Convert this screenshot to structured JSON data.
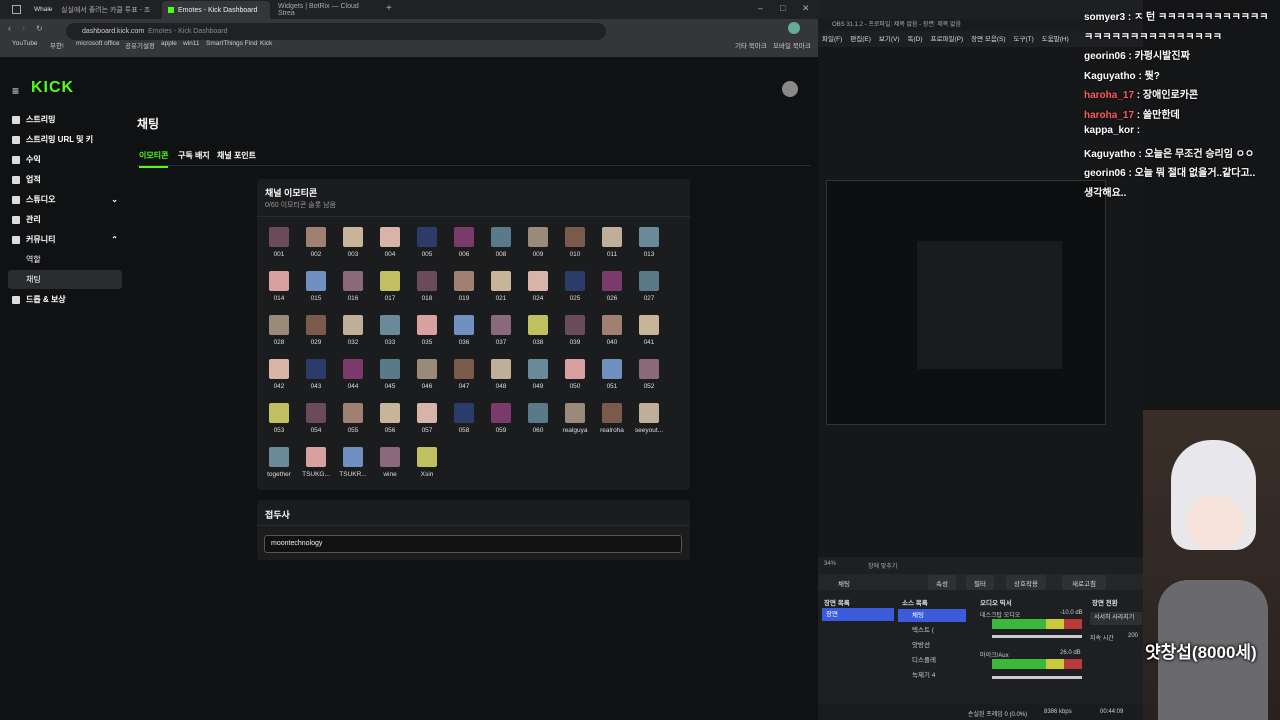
{
  "browser": {
    "app": "Whale",
    "tabs": [
      "실실에서 좋려는 카클 투표 - 조",
      "Emotes - Kick Dashboard",
      "Widgets | BotRix — Cloud Strea"
    ],
    "url": "dashboard.kick.com",
    "url_title": "Emotes - Kick Dashboard",
    "bookmarks": [
      "YouTube",
      "무한!",
      "microsoft office",
      "공유기설정",
      "apple",
      "win11",
      "SmartThings Find",
      "Kick"
    ],
    "bookmarks_right": [
      "기타 북마크",
      "모바일 북마크"
    ]
  },
  "kick": {
    "logo": "KICK",
    "sidebar": [
      {
        "label": "스트리밍",
        "icon": "video-icon"
      },
      {
        "label": "스트리밍 URL 및 키",
        "icon": "key-icon"
      },
      {
        "label": "수익",
        "icon": "money-icon"
      },
      {
        "label": "업적",
        "icon": "trophy-icon"
      },
      {
        "label": "스튜디오",
        "icon": "studio-icon"
      },
      {
        "label": "관리",
        "icon": "wrench-icon"
      },
      {
        "label": "커뮤니티",
        "icon": "community-icon"
      },
      {
        "label": "역할",
        "icon": ""
      },
      {
        "label": "채팅",
        "icon": ""
      },
      {
        "label": "드롭 & 보상",
        "icon": "gift-icon"
      }
    ],
    "page_title": "채팅",
    "tabs": [
      "이모티콘",
      "구독 배지",
      "채널 포인트"
    ],
    "emote_panel": {
      "title": "채널 이모티콘",
      "subtitle": "0/60 이모티콘 슬롯 남음"
    },
    "emotes": [
      "001",
      "002",
      "003",
      "004",
      "005",
      "006",
      "008",
      "009",
      "010",
      "011",
      "013",
      "014",
      "015",
      "016",
      "017",
      "018",
      "019",
      "021",
      "024",
      "025",
      "026",
      "027",
      "028",
      "029",
      "032",
      "033",
      "035",
      "036",
      "037",
      "038",
      "039",
      "040",
      "041",
      "042",
      "043",
      "044",
      "045",
      "046",
      "047",
      "048",
      "049",
      "050",
      "051",
      "052",
      "053",
      "054",
      "055",
      "056",
      "057",
      "058",
      "059",
      "060",
      "realguya",
      "realroha",
      "seeyout...",
      "together",
      "TSUKG...",
      "TSUKR...",
      "wine",
      "Xsin"
    ],
    "prefix": {
      "title": "접두사",
      "value": "moontechnology"
    }
  },
  "obs": {
    "title": "OBS 31.1.2 - 프로파일: 제목 없음 - 장면: 제목 없음",
    "menu": [
      "파일(F)",
      "편집(E)",
      "보기(V)",
      "독(D)",
      "프로파일(P)",
      "장면 모음(S)",
      "도구(T)",
      "도움말(H)"
    ],
    "zoom": "34%",
    "zoom_label": "창에 맞추기",
    "scene_name": "채팅",
    "toolbar": [
      "속성",
      "필터",
      "상호작용",
      "새로고침"
    ],
    "panels": {
      "scenes": "장면 목록",
      "sources": "소스 목록",
      "mixer": "오디오 믹서",
      "transitions": "장면 전환"
    },
    "scene_items": [
      "장면"
    ],
    "source_items": [
      "채팅",
      "텍스트 (",
      "앗방선",
      "디스플레",
      "녹제기 4"
    ],
    "mixer": [
      {
        "name": "데스크탑 오디오",
        "db": "-10.0 dB"
      },
      {
        "name": "마이크/Aux",
        "db": "26.0 dB"
      }
    ],
    "transition": {
      "name": "서서히 사라지기",
      "duration_label": "지속 시간",
      "duration": "200"
    },
    "status": {
      "frames": "손실된 프레임 0 (0.0%)",
      "bitrate": "8386 kbps",
      "time": "00:44:09"
    }
  },
  "chat": [
    {
      "name": "somyer3",
      "text": "ㅈ 턴 ㅋㅋㅋㅋㅋㅋㅋㅋㅋㅋㅋㅋ",
      "red": false
    },
    {
      "name": "",
      "text": "ㅋㅋㅋㅋㅋㅋㅋㅋㅋㅋㅋㅋㅋㅋㅋ",
      "red": false
    },
    {
      "name": "georin06",
      "text": "카펑시발진짜",
      "red": false
    },
    {
      "name": "Kaguyatho",
      "text": "뭣?",
      "red": false
    },
    {
      "name": "haroha_17",
      "text": "장애인로카콘",
      "red": true
    },
    {
      "name": "haroha_17",
      "text": "쓸만한데",
      "red": true
    },
    {
      "name": "kappa_kor",
      "text": "",
      "red": false
    },
    {
      "name": "Kaguyatho",
      "text": "오늘은 무조건 승리임 ㅇㅇ",
      "red": false
    },
    {
      "name": "georin06",
      "text": "오늘 뭐 절대 없을거..같다고..",
      "red": false
    },
    {
      "name": "",
      "text": "생각해요..",
      "red": false
    }
  ],
  "overlay": {
    "caption": "얏창섭(8000세)"
  },
  "colors": {
    "kick_green": "#53fc18",
    "obs_bg": "#1e1f22",
    "mixer_green": "#3ab83a"
  }
}
